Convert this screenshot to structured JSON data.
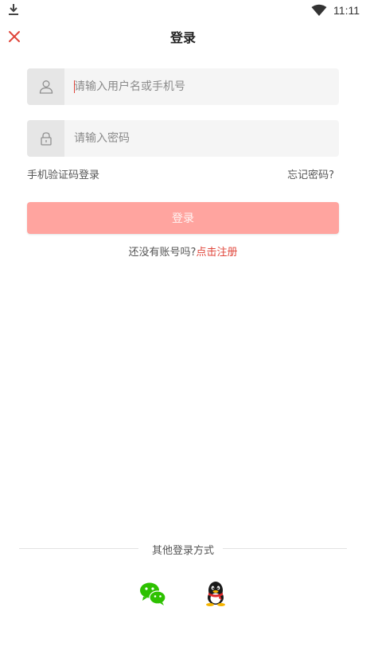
{
  "status_bar": {
    "time": "11:11"
  },
  "header": {
    "title": "登录"
  },
  "form": {
    "username_placeholder": "请输入用户名或手机号",
    "password_placeholder": "请输入密码"
  },
  "links": {
    "sms_login": "手机验证码登录",
    "forgot_password": "忘记密码?"
  },
  "login_button": "登录",
  "register": {
    "prompt": "还没有账号吗?",
    "link": "点击注册"
  },
  "other_login": {
    "label": "其他登录方式"
  },
  "colors": {
    "accent": "#e0453a",
    "button": "#ffa49f"
  },
  "icons": {
    "close": "close-icon",
    "user": "user-icon",
    "lock": "lock-icon",
    "wechat": "wechat-icon",
    "qq": "qq-icon"
  }
}
